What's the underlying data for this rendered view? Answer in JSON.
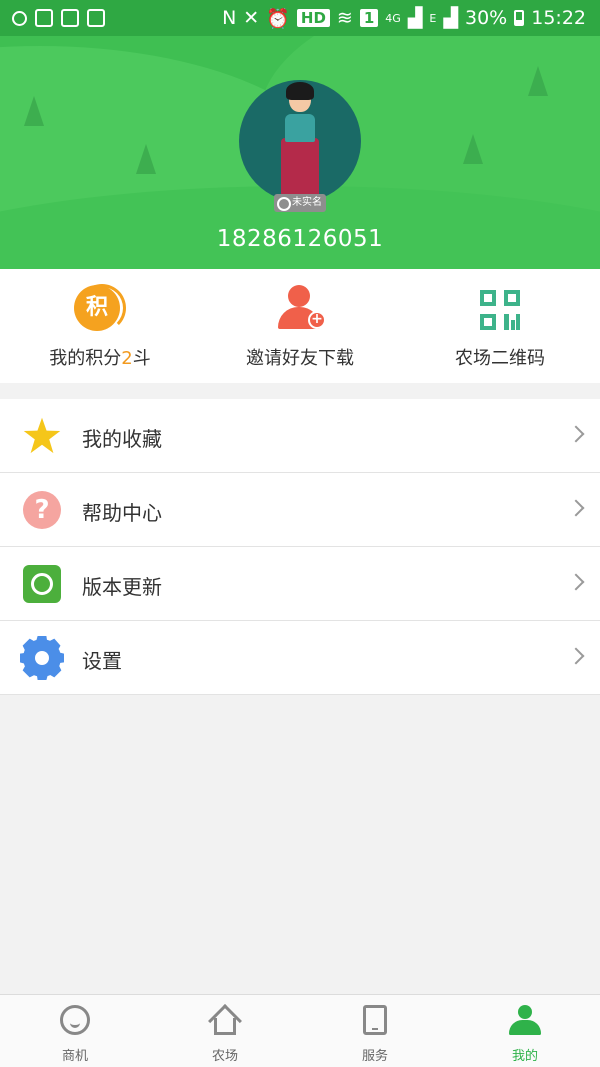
{
  "status_bar": {
    "network": "4G",
    "data_type": "E",
    "battery": "30%",
    "time": "15:22",
    "hd_label": "HD",
    "sim_label": "1"
  },
  "profile": {
    "badge": "未实名",
    "phone": "18286126051"
  },
  "quick_actions": {
    "points": {
      "icon_char": "积",
      "label_prefix": "我的积分",
      "value": "2",
      "label_suffix": "斗"
    },
    "invite": {
      "label": "邀请好友下载"
    },
    "qrcode": {
      "label": "农场二维码"
    }
  },
  "menu": [
    {
      "label": "我的收藏",
      "icon": "star-icon"
    },
    {
      "label": "帮助中心",
      "icon": "help-icon",
      "icon_char": "?"
    },
    {
      "label": "版本更新",
      "icon": "update-icon"
    },
    {
      "label": "设置",
      "icon": "gear-icon"
    }
  ],
  "tabs": [
    {
      "label": "商机",
      "icon": "chat-icon"
    },
    {
      "label": "农场",
      "icon": "home-icon"
    },
    {
      "label": "服务",
      "icon": "tablet-icon"
    },
    {
      "label": "我的",
      "icon": "user-icon",
      "active": true
    }
  ],
  "colors": {
    "header_green": "#3fbf52",
    "active_tab": "#2fb24a",
    "points_orange": "#f5a21f",
    "invite_red": "#f0604a",
    "qr_teal": "#3db38a"
  }
}
